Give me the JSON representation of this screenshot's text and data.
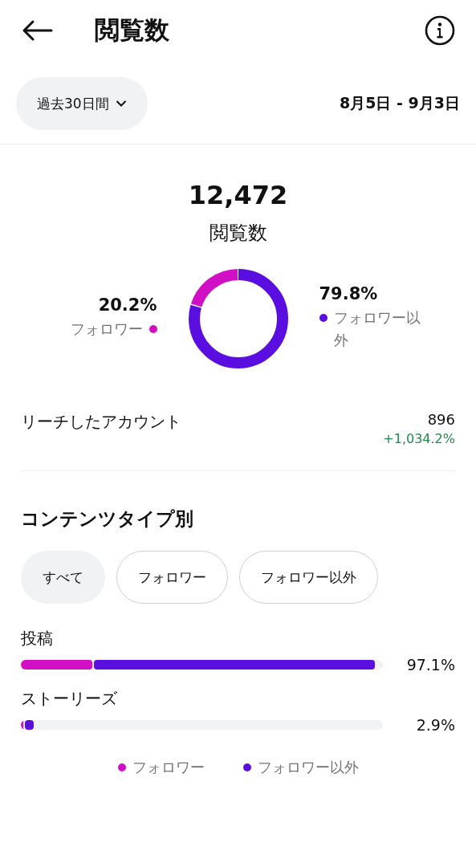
{
  "header": {
    "title": "閲覧数"
  },
  "period": {
    "label": "過去30日間",
    "range": "8月5日 - 9月3日"
  },
  "summary": {
    "total": "12,472",
    "label": "閲覧数",
    "legend": [
      {
        "value": "20.2%",
        "label": "フォロワー",
        "color": "#d10fc4"
      },
      {
        "value": "79.8%",
        "label": "フォロワー以外",
        "color": "#5a0fe0"
      }
    ]
  },
  "reach": {
    "label": "リーチしたアカウント",
    "value": "896",
    "change": "+1,034.2%"
  },
  "content_type": {
    "title": "コンテンツタイプ別",
    "filters": [
      {
        "label": "すべて",
        "selected": true
      },
      {
        "label": "フォロワー",
        "selected": false
      },
      {
        "label": "フォロワー以外",
        "selected": false
      }
    ],
    "rows": [
      {
        "label": "投稿",
        "value": "97.1%"
      },
      {
        "label": "ストーリーズ",
        "value": "2.9%"
      }
    ],
    "legend": [
      {
        "label": "フォロワー",
        "color": "#d10fc4"
      },
      {
        "label": "フォロワー以外",
        "color": "#5a0fe0"
      }
    ]
  }
}
